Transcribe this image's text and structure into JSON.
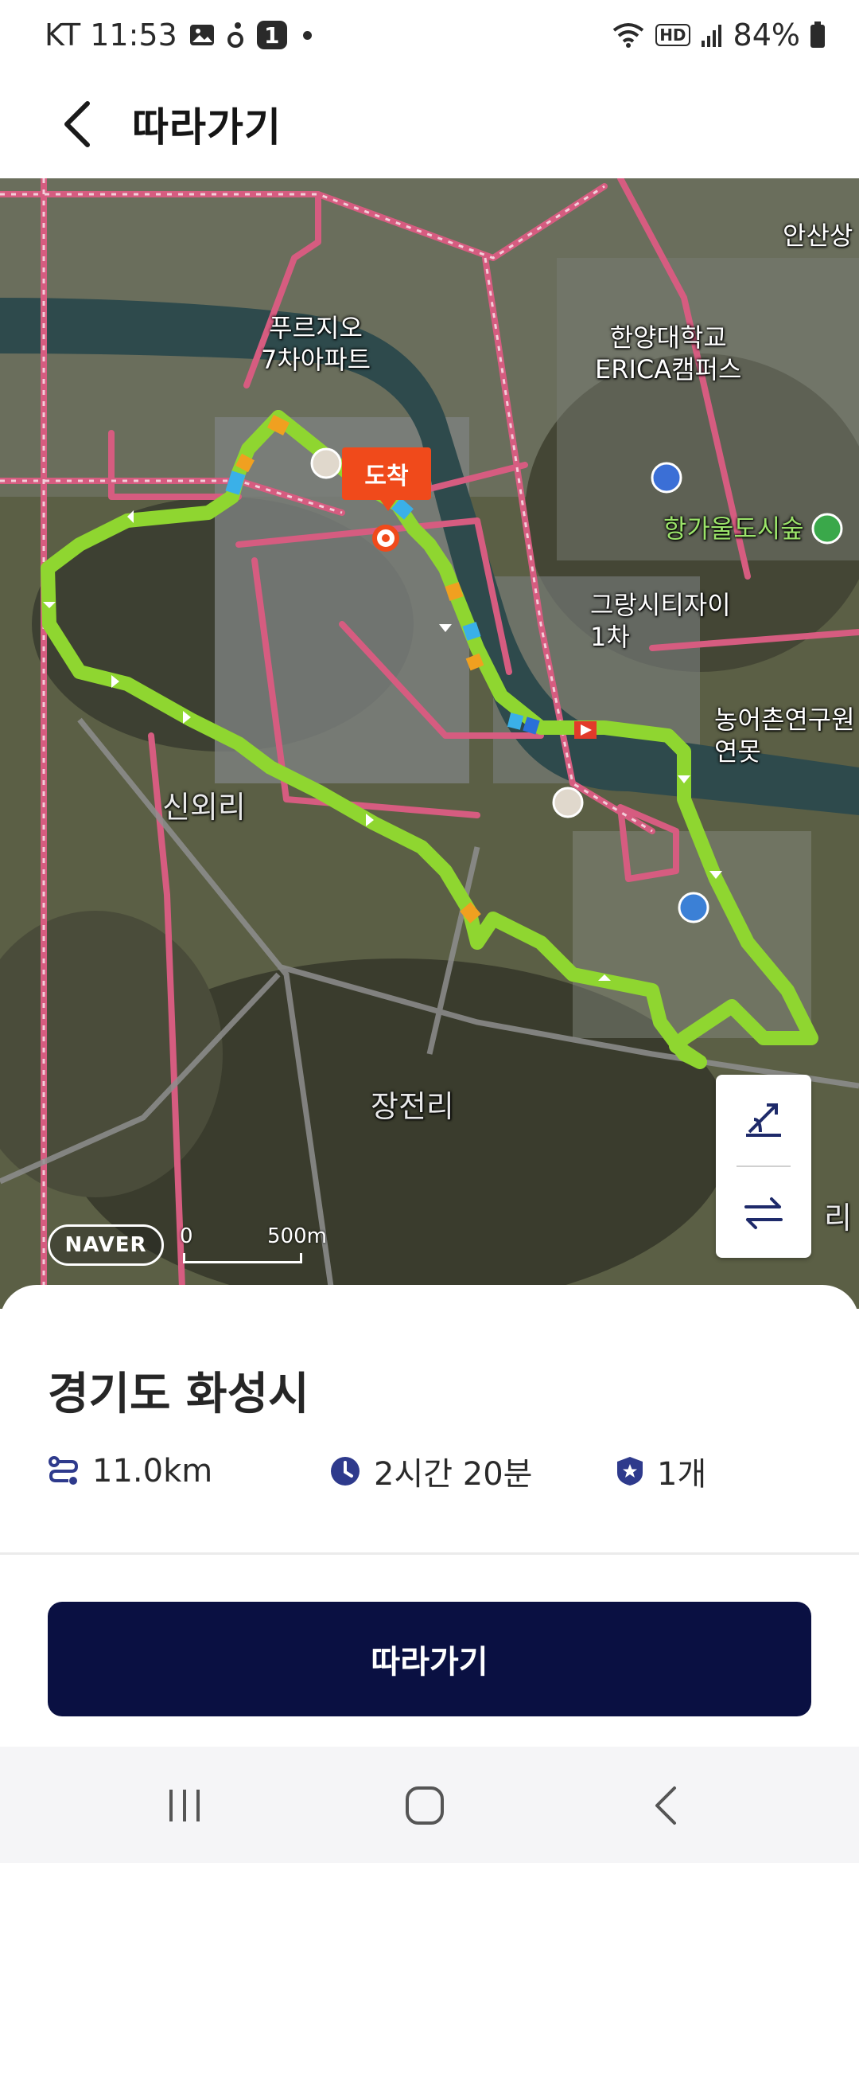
{
  "status_bar": {
    "carrier_time": "KT 11:53",
    "notification_badge": "1",
    "hd_label": "HD",
    "battery": "84%"
  },
  "header": {
    "title": "따라가기"
  },
  "map": {
    "labels": {
      "purgio": "푸르지오\n7차아파트",
      "hanyang": "한양대학교\nERICA캠퍼스",
      "ansan": "안산상",
      "hanggaul": "항가울도시숲",
      "grang": "그랑시티자이\n1차",
      "nongeochon": "농어촌연구원\n연못",
      "sinoeri": "신외리",
      "jangjeonri": "장전리",
      "edge_ri": "리"
    },
    "arrival_label": "도착",
    "naver_logo": "NAVER",
    "scale_zero": "0",
    "scale_distance": "500m",
    "colors": {
      "route": "#8fd630",
      "road": "#d65c80",
      "river": "#2e4a4c",
      "arrival": "#f04a1b"
    }
  },
  "summary": {
    "region": "경기도 화성시",
    "distance": "11.0km",
    "duration": "2시간 20분",
    "count": "1개",
    "icons": [
      "route-icon",
      "clock-icon",
      "shield-star-icon"
    ]
  },
  "actions": {
    "follow_label": "따라가기",
    "button_color": "#0a1042"
  },
  "nav_bar": {
    "icons": [
      "recent-apps-icon",
      "home-icon",
      "back-icon"
    ]
  }
}
